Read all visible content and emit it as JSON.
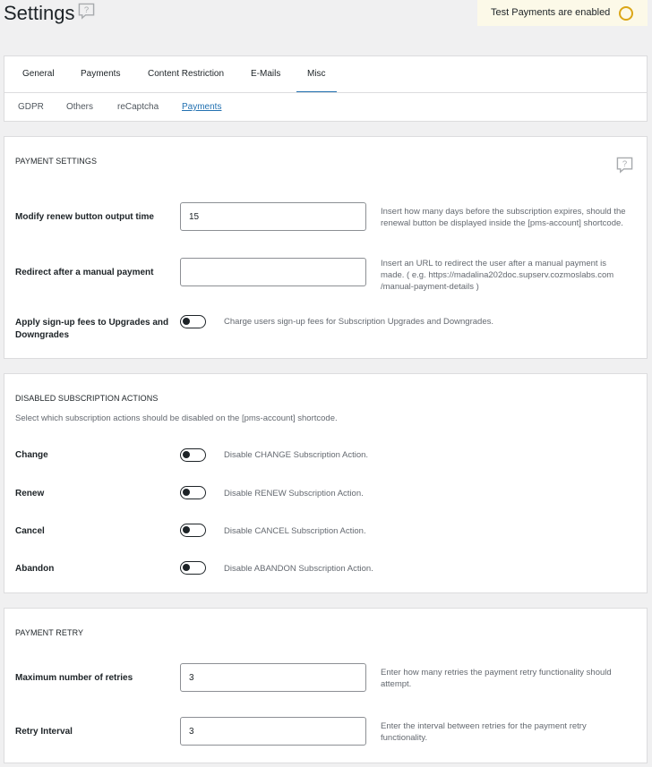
{
  "header": {
    "title": "Settings",
    "help_icon": "help-bubble-icon",
    "test_badge": "Test Payments are enabled",
    "badge_indicator_color": "#dba617"
  },
  "tabs": [
    {
      "label": "General",
      "active": false
    },
    {
      "label": "Payments",
      "active": false
    },
    {
      "label": "Content Restriction",
      "active": false
    },
    {
      "label": "E-Mails",
      "active": false
    },
    {
      "label": "Misc",
      "active": true
    }
  ],
  "subtabs": [
    {
      "label": "GDPR",
      "active": false
    },
    {
      "label": "Others",
      "active": false
    },
    {
      "label": "reCaptcha",
      "active": false
    },
    {
      "label": "Payments",
      "active": true
    }
  ],
  "payment_settings": {
    "title": "PAYMENT SETTINGS",
    "help_icon": "help-bubble-icon",
    "renew": {
      "label": "Modify renew button output time",
      "value": "15",
      "desc": "Insert how many days before the subscription expires, should the renewal button be displayed inside the [pms-account] shortcode."
    },
    "redirect": {
      "label": "Redirect after a manual payment",
      "value": "",
      "desc": "Insert an URL to redirect the user after a manual payment is made. ( e.g. https://madalina202doc.supserv.cozmoslabs.com /manual-payment-details )"
    },
    "signup_fees": {
      "label": "Apply sign-up fees to Upgrades and Downgrades",
      "desc": "Charge users sign-up fees for Subscription Upgrades and Downgrades.",
      "enabled": false
    }
  },
  "disabled_actions": {
    "title": "DISABLED SUBSCRIPTION ACTIONS",
    "subtitle": "Select which subscription actions should be disabled on the [pms-account] shortcode.",
    "items": [
      {
        "label": "Change",
        "desc": "Disable CHANGE Subscription Action.",
        "enabled": false
      },
      {
        "label": "Renew",
        "desc": "Disable RENEW Subscription Action.",
        "enabled": false
      },
      {
        "label": "Cancel",
        "desc": "Disable CANCEL Subscription Action.",
        "enabled": false
      },
      {
        "label": "Abandon",
        "desc": "Disable ABANDON Subscription Action.",
        "enabled": false
      }
    ]
  },
  "payment_retry": {
    "title": "PAYMENT RETRY",
    "max_retries": {
      "label": "Maximum number of retries",
      "value": "3",
      "desc": "Enter how many retries the payment retry functionality should attempt."
    },
    "interval": {
      "label": "Retry Interval",
      "value": "3",
      "desc": "Enter the interval between retries for the payment retry functionality."
    }
  }
}
